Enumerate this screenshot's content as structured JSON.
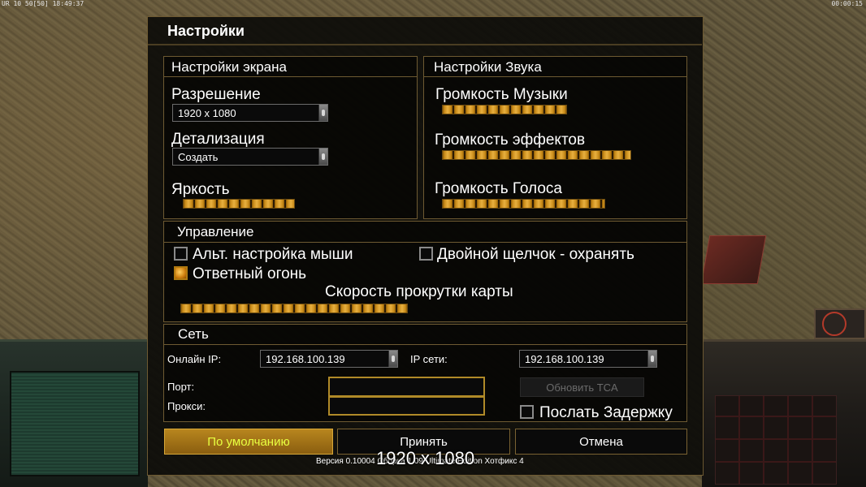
{
  "overlay": {
    "top_left": "UR 10 50[50] 18:49:37",
    "top_right": "00:00:15",
    "resolution": "1920 x 1080"
  },
  "dialog": {
    "title": "Настройки",
    "version": "Версия 0.10004 Сборка 1.09 Ultimate Edition Хотфикс 4"
  },
  "display": {
    "heading": "Настройки экрана",
    "resolution_label": "Разрешение",
    "resolution_value": "1920 x 1080",
    "detail_label": "Детализация",
    "detail_value": "Создать",
    "brightness_label": "Яркость",
    "brightness_level": 9
  },
  "sound": {
    "heading": "Настройки Звука",
    "music_label": "Громкость Музыки",
    "music_level": 11,
    "effects_label": "Громкость эффектов",
    "effects_level": 16,
    "voice_label": "Громкость Голоса",
    "voice_level": 14
  },
  "controls": {
    "heading": "Управление",
    "alt_mouse_label": "Альт. настройка мыши",
    "alt_mouse_checked": false,
    "double_click_label": "Двойной щелчок - охранять",
    "double_click_checked": false,
    "return_fire_label": "Ответный огонь",
    "return_fire_checked": true,
    "scroll_speed_label": "Скорость прокрутки карты",
    "scroll_speed_level": 20
  },
  "network": {
    "heading": "Сеть",
    "online_ip_label": "Онлайн IP:",
    "online_ip_value": "192.168.100.139",
    "lan_ip_label": "IP сети:",
    "lan_ip_value": "192.168.100.139",
    "port_label": "Порт:",
    "port_value": "",
    "proxy_label": "Прокси:",
    "proxy_value": "",
    "update_tca_label": "Обновить TCA",
    "send_delay_label": "Послать Задержку",
    "send_delay_checked": false
  },
  "buttons": {
    "default_label": "По умолчанию",
    "accept_label": "Принять",
    "cancel_label": "Отмена"
  },
  "colors": {
    "frame": "#6e5a32",
    "slider_gold": "#e8b040",
    "default_button_text": "#e8ff40"
  }
}
